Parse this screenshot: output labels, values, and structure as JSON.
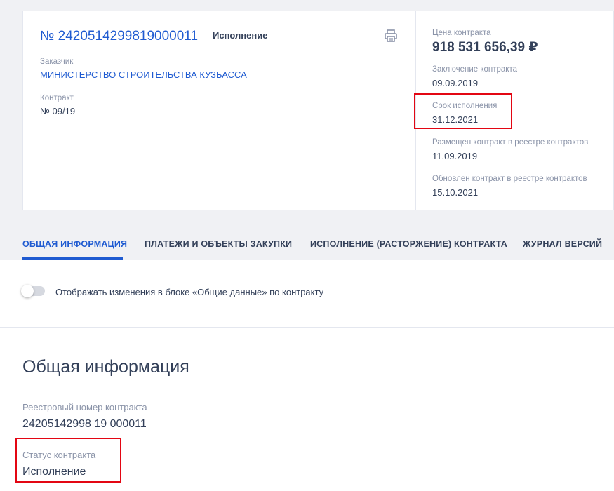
{
  "header": {
    "reg_number": "№ 2420514299819000011",
    "status": "Исполнение",
    "customer_label": "Заказчик",
    "customer_name": "МИНИСТЕРСТВО СТРОИТЕЛЬСТВА КУЗБАССА",
    "contract_label": "Контракт",
    "contract_number": "№ 09/19",
    "print_icon": "print-icon"
  },
  "summary": {
    "price_label": "Цена контракта",
    "price_value": "918 531 656,39 ₽",
    "conclusion_label": "Заключение контракта",
    "conclusion_date": "09.09.2019",
    "deadline_label": "Срок исполнения",
    "deadline_date": "31.12.2021",
    "placed_label": "Размещен контракт в реестре контрактов",
    "placed_date": "11.09.2019",
    "updated_label": "Обновлен контракт в реестре контрактов",
    "updated_date": "15.10.2021"
  },
  "tabs": [
    {
      "label": "ОБЩАЯ ИНФОРМАЦИЯ",
      "active": true
    },
    {
      "label": "ПЛАТЕЖИ И ОБЪЕКТЫ ЗАКУПКИ",
      "active": false
    },
    {
      "label": "ИСПОЛНЕНИЕ (РАСТОРЖЕНИЕ) КОНТРАКТА",
      "active": false
    },
    {
      "label": "ЖУРНАЛ ВЕРСИЙ",
      "active": false
    }
  ],
  "toggle": {
    "label": "Отображать изменения в блоке «Общие данные» по контракту",
    "on": false
  },
  "general": {
    "title": "Общая информация",
    "reg_label": "Реестровый номер контракта",
    "reg_value": "24205142998 19 000011",
    "status_label": "Статус контракта",
    "status_value": "Исполнение"
  },
  "colors": {
    "accent": "#1f5bd1",
    "highlight": "#e30613",
    "text": "#334059",
    "muted": "#8a93a8"
  }
}
